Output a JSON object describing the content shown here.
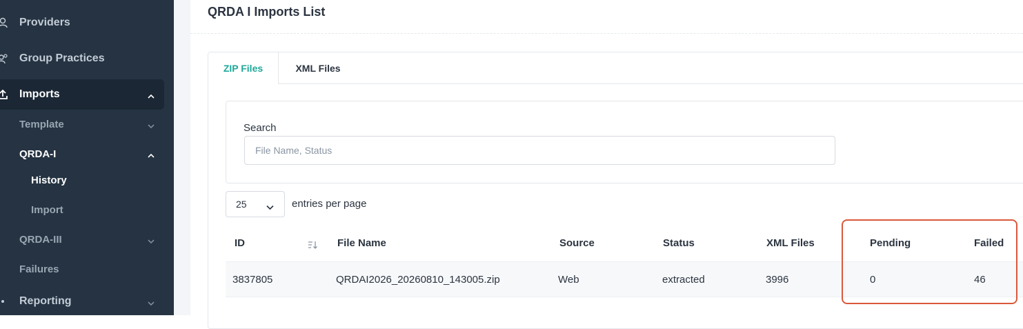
{
  "sidebar": {
    "items": [
      {
        "label": "Providers",
        "icon": "user-icon"
      },
      {
        "label": "Group Practices",
        "icon": "group-icon"
      },
      {
        "label": "Imports",
        "icon": "upload-icon"
      },
      {
        "label": "Reporting",
        "icon": "reporting-icon"
      }
    ],
    "sub_items": {
      "template": "Template",
      "qrda_i": "QRDA-I",
      "history": "History",
      "import": "Import",
      "qrda_iii": "QRDA-III",
      "failures": "Failures"
    }
  },
  "page": {
    "title": "QRDA I Imports List"
  },
  "tabs": [
    "ZIP Files",
    "XML Files"
  ],
  "search": {
    "label": "Search",
    "placeholder": "File Name, Status",
    "value": ""
  },
  "entries": {
    "selected": "25",
    "label": "entries per page"
  },
  "table": {
    "columns": [
      "ID",
      "File Name",
      "Source",
      "Status",
      "XML Files",
      "Pending",
      "Failed"
    ],
    "rows": [
      {
        "id": "3837805",
        "file_name": "QRDAI2026_20260810_143005.zip",
        "source": "Web",
        "status": "extracted",
        "xml_files": "3996",
        "pending": "0",
        "failed": "46"
      }
    ]
  },
  "colors": {
    "accent": "#1fa89a",
    "sidebar_bg": "#253342",
    "highlight": "#d9583b"
  }
}
